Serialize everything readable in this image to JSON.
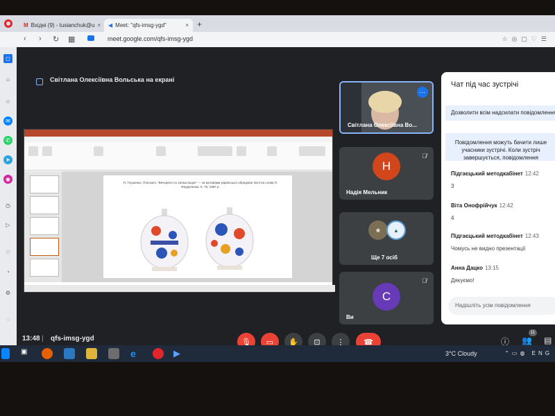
{
  "browser": {
    "tabs": [
      {
        "label": "Вхідні (9) - tusianchuk@u",
        "active": false
      },
      {
        "label": "Meet: \"qfs-imsg-ygd\"",
        "active": true
      }
    ],
    "url": "meet.google.com/qfs-imsg-ygd"
  },
  "meet": {
    "presenting_banner": "Світлана Олексіївна Вольська на екрані",
    "time": "13:48",
    "separator": "|",
    "meeting_code": "qfs-imsg-ygd",
    "participant_count": "11"
  },
  "slide": {
    "caption": "П. Глушенко. Плескачі. \"Вечорело по хаташ воцех\" — за мотивами української обрядової пісні на слова П. Федорченка. К. 70, 1967 р."
  },
  "participants": [
    {
      "name": "Світлана Олексіївна Во...",
      "type": "video"
    },
    {
      "name": "Надія Мельник",
      "initial": "Н",
      "color": "#d2461b",
      "muted": true
    },
    {
      "name": "Ще 7 осіб",
      "type": "group"
    },
    {
      "name": "Ви",
      "initial": "С",
      "color": "#673ab7",
      "muted": true
    }
  ],
  "chat": {
    "title": "Чат під час зустрічі",
    "toggle_label": "Дозволити всім надсилати повідомлення",
    "notice": "Повідомлення можуть бачити лише учасники зустрічі. Коли зустріч завершується, повідомлення видаляються.",
    "messages": [
      {
        "sender": "Підгаєцький методкабінет",
        "time": "12:42",
        "text": "3"
      },
      {
        "sender": "Віта Онофрійчук",
        "time": "12:42",
        "text": "4"
      },
      {
        "sender": "Підгаєцький методкабінет",
        "time": "12:43",
        "text": "Чомусь не видно презентації"
      },
      {
        "sender": "Анна Дацко",
        "time": "13:15",
        "text": "Дякуємо!"
      }
    ],
    "input_placeholder": "Надішліть усім повідомлення"
  },
  "taskbar": {
    "weather": "3°C  Cloudy",
    "lang": "ENG"
  }
}
